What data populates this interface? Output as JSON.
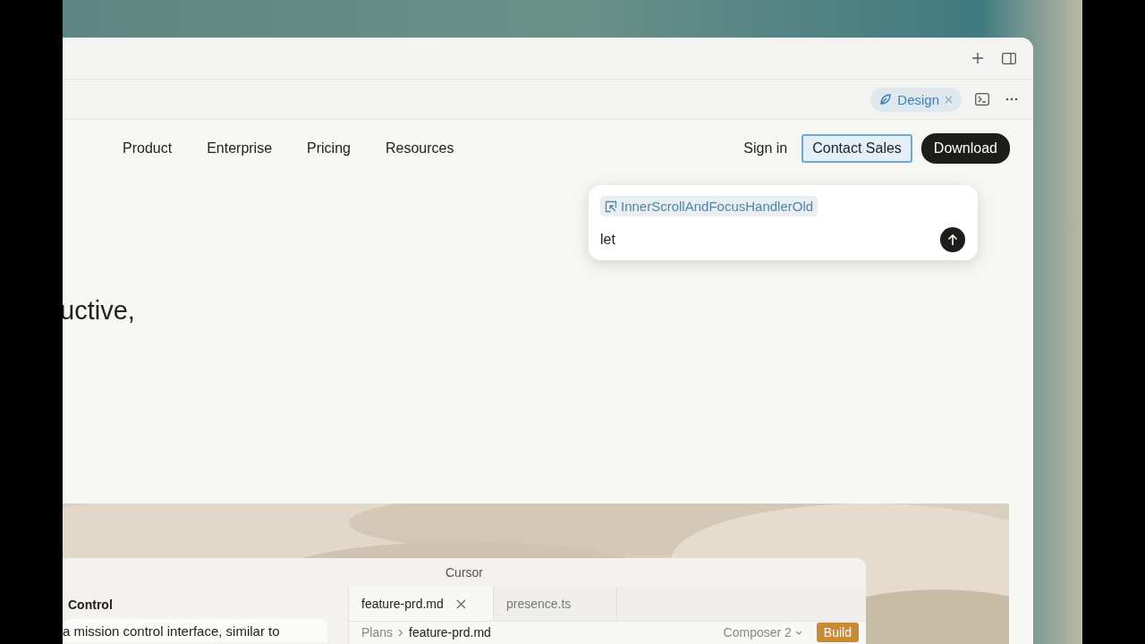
{
  "browser": {
    "toolbar": {
      "chip": {
        "label": "Design"
      }
    }
  },
  "site_nav": {
    "links": [
      "Product",
      "Enterprise",
      "Pricing",
      "Resources"
    ],
    "sign_in": "Sign in",
    "contact": "Contact Sales",
    "download": "Download"
  },
  "hero": {
    "heading": "uctive,"
  },
  "comment_popup": {
    "chip": "InnerScrollAndFocusHandlerOld",
    "value": "let"
  },
  "app_window": {
    "title": "Cursor",
    "sidebar": {
      "heading": "Control",
      "message": "a mission control interface, similar to"
    },
    "tabs": [
      {
        "label": "feature-prd.md",
        "selected": true
      },
      {
        "label": "presence.ts",
        "selected": false
      }
    ],
    "breadcrumb": [
      "Plans",
      "feature-prd.md"
    ],
    "model": "Composer 2",
    "build": "Build"
  }
}
